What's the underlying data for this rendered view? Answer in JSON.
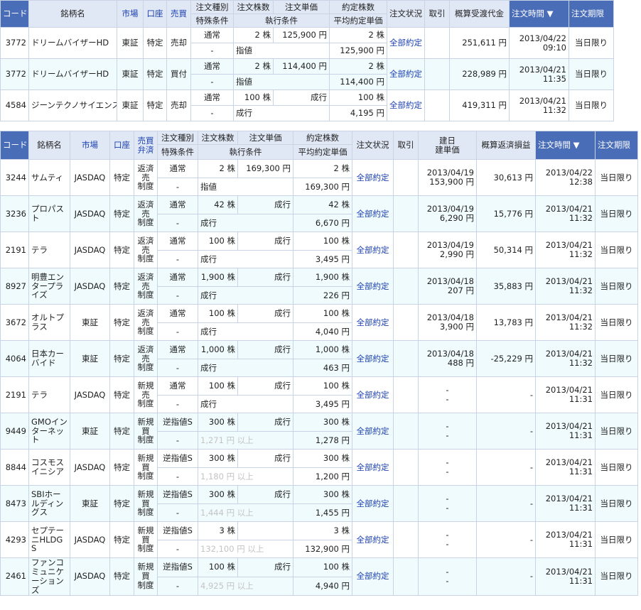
{
  "table1": {
    "header": {
      "code": "コード",
      "name": "銘柄名",
      "market": "市場",
      "account": "口座",
      "side": "売買",
      "order_type": "注文種別",
      "special": "特殊条件",
      "qty": "注文株数",
      "price": "注文単価",
      "exec_cond": "執行条件",
      "filled": "約定株数",
      "avg": "平均約定単価",
      "status": "注文状況",
      "cancel": "取引",
      "amount": "概算受渡代金",
      "time": "注文時間 ▼",
      "expiry": "注文期限"
    },
    "rows": [
      {
        "code": "3772",
        "name": "ドリームバイザーHD",
        "market": "東証",
        "account": "特定",
        "side": "売却",
        "order_type": "通常",
        "qty": "2 株",
        "price": "125,900 円",
        "filled": "2 株",
        "special": "-",
        "cond": "指値",
        "avg": "125,900 円",
        "status": "全部約定",
        "amount": "251,611 円",
        "date": "2013/04/22",
        "clock": "09:10",
        "expiry": "当日限り"
      },
      {
        "code": "3772",
        "name": "ドリームバイザーHD",
        "market": "東証",
        "account": "特定",
        "side": "買付",
        "order_type": "通常",
        "qty": "2 株",
        "price": "114,400 円",
        "filled": "2 株",
        "special": "-",
        "cond": "指値",
        "avg": "114,400 円",
        "status": "全部約定",
        "amount": "228,989 円",
        "date": "2013/04/21",
        "clock": "11:35",
        "expiry": "当日限り"
      },
      {
        "code": "4584",
        "name": "ジーンテクノサイエンス",
        "market": "東証",
        "account": "特定",
        "side": "売却",
        "order_type": "通常",
        "qty": "100 株",
        "price": "成行",
        "filled": "100 株",
        "special": "-",
        "cond": "成行",
        "avg": "4,195 円",
        "status": "全部約定",
        "amount": "419,311 円",
        "date": "2013/04/21",
        "clock": "11:32",
        "expiry": "当日限り"
      }
    ]
  },
  "table2": {
    "header": {
      "code": "コード",
      "name": "銘柄名",
      "market": "市場",
      "account": "口座",
      "side": "売買\n弁済",
      "order_type": "注文種別",
      "special": "特殊条件",
      "qty": "注文株数",
      "price": "注文単価",
      "exec_cond": "執行条件",
      "filled": "約定株数",
      "avg": "平均約定単価",
      "status": "注文状況",
      "cancel": "取引",
      "build": "建日\n建単価",
      "pl": "概算返済損益",
      "time": "注文時間 ▼",
      "expiry": "注文期限"
    },
    "rows": [
      {
        "code": "3244",
        "name": "サムティ",
        "market": "JASDAQ",
        "account": "特定",
        "side": "返済\n売\n制度",
        "order_type": "通常",
        "qty": "2 株",
        "price": "169,300 円",
        "filled": "2 株",
        "special": "-",
        "cond": "指値",
        "avg": "169,300 円",
        "status": "全部約定",
        "bdate": "2013/04/19",
        "bprice": "153,900 円",
        "pl": "30,613 円",
        "date": "2013/04/22",
        "clock": "12:38",
        "expiry": "当日限り"
      },
      {
        "code": "3236",
        "name": "プロパスト",
        "market": "JASDAQ",
        "account": "特定",
        "side": "返済\n売\n制度",
        "order_type": "通常",
        "qty": "42 株",
        "price": "成行",
        "filled": "42 株",
        "special": "-",
        "cond": "成行",
        "avg": "6,670 円",
        "status": "全部約定",
        "bdate": "2013/04/19",
        "bprice": "6,290 円",
        "pl": "15,776 円",
        "date": "2013/04/21",
        "clock": "11:32",
        "expiry": "当日限り"
      },
      {
        "code": "2191",
        "name": "テラ",
        "market": "JASDAQ",
        "account": "特定",
        "side": "返済\n売\n制度",
        "order_type": "通常",
        "qty": "100 株",
        "price": "成行",
        "filled": "100 株",
        "special": "-",
        "cond": "成行",
        "avg": "3,495 円",
        "status": "全部約定",
        "bdate": "2013/04/19",
        "bprice": "2,990 円",
        "pl": "50,314 円",
        "date": "2013/04/21",
        "clock": "11:32",
        "expiry": "当日限り"
      },
      {
        "code": "8927",
        "name": "明豊エンタープライズ",
        "market": "JASDAQ",
        "account": "特定",
        "side": "返済\n売\n制度",
        "order_type": "通常",
        "qty": "1,900 株",
        "price": "成行",
        "filled": "1,900 株",
        "special": "-",
        "cond": "成行",
        "avg": "226 円",
        "status": "全部約定",
        "bdate": "2013/04/18",
        "bprice": "207 円",
        "pl": "35,883 円",
        "date": "2013/04/21",
        "clock": "11:32",
        "expiry": "当日限り"
      },
      {
        "code": "3672",
        "name": "オルトプラス",
        "market": "東証",
        "account": "特定",
        "side": "返済\n売\n制度",
        "order_type": "通常",
        "qty": "100 株",
        "price": "成行",
        "filled": "100 株",
        "special": "-",
        "cond": "成行",
        "avg": "4,040 円",
        "status": "全部約定",
        "bdate": "2013/04/18",
        "bprice": "3,900 円",
        "pl": "13,783 円",
        "date": "2013/04/21",
        "clock": "11:32",
        "expiry": "当日限り"
      },
      {
        "code": "4064",
        "name": "日本カーバイド",
        "market": "東証",
        "account": "特定",
        "side": "返済\n売\n制度",
        "order_type": "通常",
        "qty": "1,000 株",
        "price": "成行",
        "filled": "1,000 株",
        "special": "-",
        "cond": "成行",
        "avg": "463 円",
        "status": "全部約定",
        "bdate": "2013/04/18",
        "bprice": "488 円",
        "pl": "-25,229 円",
        "date": "2013/04/21",
        "clock": "11:32",
        "expiry": "当日限り"
      },
      {
        "code": "2191",
        "name": "テラ",
        "market": "JASDAQ",
        "account": "特定",
        "side": "新規\n売\n制度",
        "order_type": "通常",
        "qty": "100 株",
        "price": "成行",
        "filled": "100 株",
        "special": "-",
        "cond": "成行",
        "avg": "3,495 円",
        "status": "全部約定",
        "bdate": "-",
        "bprice": "-",
        "pl": "-",
        "date": "2013/04/21",
        "clock": "11:31",
        "expiry": "当日限り"
      },
      {
        "code": "9449",
        "name": "GMOインターネット",
        "market": "東証",
        "account": "特定",
        "side": "新規\n買\n制度",
        "order_type": "逆指値S",
        "qty": "300 株",
        "price": "成行",
        "filled": "300 株",
        "special": "-",
        "cond": "1,271 円 以上",
        "avg": "1,278 円",
        "status": "全部約定",
        "bdate": "-",
        "bprice": "-",
        "pl": "-",
        "date": "2013/04/21",
        "clock": "11:31",
        "expiry": "当日限り"
      },
      {
        "code": "8844",
        "name": "コスモスイニシア",
        "market": "JASDAQ",
        "account": "特定",
        "side": "新規\n買\n制度",
        "order_type": "逆指値S",
        "qty": "300 株",
        "price": "成行",
        "filled": "300 株",
        "special": "-",
        "cond": "1,180 円 以上",
        "avg": "1,200 円",
        "status": "全部約定",
        "bdate": "-",
        "bprice": "-",
        "pl": "-",
        "date": "2013/04/21",
        "clock": "11:31",
        "expiry": "当日限り"
      },
      {
        "code": "8473",
        "name": "SBIホールディングス",
        "market": "東証",
        "account": "特定",
        "side": "新規\n買\n制度",
        "order_type": "逆指値S",
        "qty": "300 株",
        "price": "成行",
        "filled": "300 株",
        "special": "-",
        "cond": "1,444 円 以上",
        "avg": "1,455 円",
        "status": "全部約定",
        "bdate": "-",
        "bprice": "-",
        "pl": "-",
        "date": "2013/04/21",
        "clock": "11:31",
        "expiry": "当日限り"
      },
      {
        "code": "4293",
        "name": "セプテーニHLDGS",
        "market": "JASDAQ",
        "account": "特定",
        "side": "新規\n買\n制度",
        "order_type": "逆指値S",
        "qty": "3 株",
        "price": "",
        "filled": "3 株",
        "special": "-",
        "cond": "132,100 円 以上",
        "avg": "132,900 円",
        "status": "全部約定",
        "bdate": "-",
        "bprice": "-",
        "pl": "-",
        "date": "2013/04/21",
        "clock": "11:31",
        "expiry": "当日限り"
      },
      {
        "code": "2461",
        "name": "ファンコミュニケーションズ",
        "market": "JASDAQ",
        "account": "特定",
        "side": "新規\n買\n制度",
        "order_type": "逆指値S",
        "qty": "100 株",
        "price": "成行",
        "filled": "100 株",
        "special": "-",
        "cond": "4,925 円 以上",
        "avg": "4,940 円",
        "status": "全部約定",
        "bdate": "-",
        "bprice": "-",
        "pl": "-",
        "date": "2013/04/21",
        "clock": "11:31",
        "expiry": "当日限り"
      }
    ]
  },
  "colors": {
    "header_blue": "#4a6db8",
    "header_light": "#e1e8f5",
    "row_alt": "#f0fbfd",
    "link": "#1a3fb0",
    "border": "#c8d3e6",
    "muted": "#c4c4c4"
  }
}
